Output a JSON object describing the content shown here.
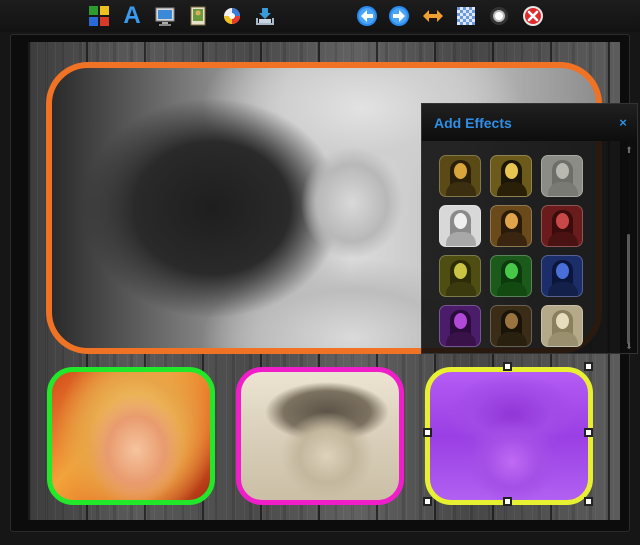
{
  "toolbar": {
    "buttons": [
      {
        "name": "layout-icon"
      },
      {
        "name": "text-icon"
      },
      {
        "name": "background-icon"
      },
      {
        "name": "photo-icon"
      },
      {
        "name": "clipart-icon"
      },
      {
        "name": "save-icon"
      },
      {
        "name": "undo-icon"
      },
      {
        "name": "redo-icon"
      },
      {
        "name": "swap-icon"
      },
      {
        "name": "pattern-icon"
      },
      {
        "name": "glow-icon"
      },
      {
        "name": "delete-icon"
      }
    ],
    "text_icon_glyph": "A"
  },
  "effects_panel": {
    "title": "Add Effects",
    "close_label": "×",
    "scroll_up": "⬆",
    "scroll_down": "⬇",
    "thumbnails": [
      {
        "effect": "gold-tint",
        "bg": "#5a4a16",
        "hair": "#2a200a",
        "face": "#d9a63c",
        "body": "#3b2f10"
      },
      {
        "effect": "golden",
        "bg": "#6b5a1a",
        "hair": "#1c1608",
        "face": "#e8c450",
        "body": "#2a2008"
      },
      {
        "effect": "emboss",
        "bg": "#8c8c86",
        "hair": "#6e6e68",
        "face": "#b8b8b0",
        "body": "#7a7a74"
      },
      {
        "effect": "sketch",
        "bg": "#d8d8d8",
        "hair": "#8a8a8a",
        "face": "#efefef",
        "body": "#a8a8a8"
      },
      {
        "effect": "vivid",
        "bg": "#6a4a1a",
        "hair": "#2a1a08",
        "face": "#e0a44a",
        "body": "#3a2610"
      },
      {
        "effect": "red-tint",
        "bg": "#6a1c1c",
        "hair": "#3a0c0c",
        "face": "#c84848",
        "body": "#4a1212"
      },
      {
        "effect": "yellow-tint",
        "bg": "#4e4e12",
        "hair": "#2c2c08",
        "face": "#c8c444",
        "body": "#3a3a0e"
      },
      {
        "effect": "green-tint",
        "bg": "#1c5a1c",
        "hair": "#0c3a0c",
        "face": "#48c848",
        "body": "#124a12"
      },
      {
        "effect": "blue-tint",
        "bg": "#1c2e6a",
        "hair": "#0c163a",
        "face": "#4870d8",
        "body": "#12204a"
      },
      {
        "effect": "purple-tint",
        "bg": "#4a1c6a",
        "hair": "#2a0c3a",
        "face": "#b048d8",
        "body": "#3a124a"
      },
      {
        "effect": "dark-warm",
        "bg": "#3a2c16",
        "hair": "#1a1408",
        "face": "#9a7440",
        "body": "#2a2010"
      },
      {
        "effect": "pale",
        "bg": "#b4aa8a",
        "hair": "#8a805e",
        "face": "#e6dcbe",
        "body": "#9a9070"
      }
    ]
  },
  "frames": {
    "main": {
      "border_color": "#f07224"
    },
    "small": [
      {
        "border_color": "#22e82a"
      },
      {
        "border_color": "#f01ec8"
      },
      {
        "border_color": "#e8f032",
        "selected": true
      }
    ]
  }
}
